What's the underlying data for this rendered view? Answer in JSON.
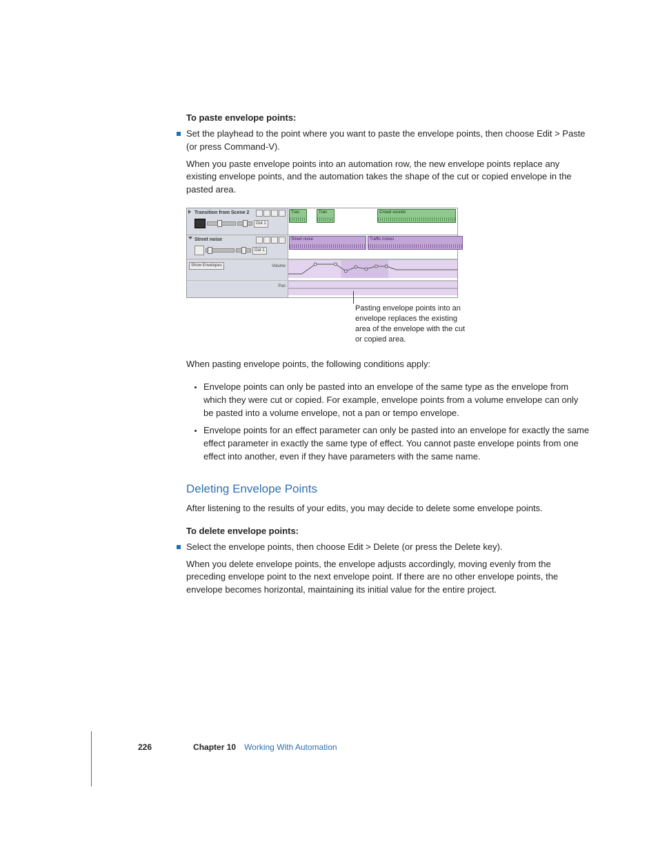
{
  "headings": {
    "paste_title": "To paste envelope points:",
    "delete_title": "To delete envelope points:",
    "section_title": "Deleting Envelope Points"
  },
  "body": {
    "paste_bullet": "Set the playhead to the point where you want to paste the envelope points, then choose Edit > Paste (or press Command-V).",
    "paste_para1": "When you paste envelope points into an automation row, the new envelope points replace any existing envelope points, and the automation takes the shape of the cut or copied envelope in the pasted area.",
    "caption": "Pasting envelope points into an envelope replaces the existing area of the envelope with the cut or copied area.",
    "conditions_intro": "When pasting envelope points, the following conditions apply:",
    "cond1": "Envelope points can only be pasted into an envelope of the same type as the envelope from which they were cut or copied. For example, envelope points from a volume envelope can only be pasted into a volume envelope, not a pan or tempo envelope.",
    "cond2": "Envelope points for an effect parameter can only be pasted into an envelope for exactly the same effect parameter in exactly the same type of effect. You cannot paste envelope points from one effect into another, even if they have parameters with the same name.",
    "delete_intro": "After listening to the results of your edits, you may decide to delete some envelope points.",
    "delete_bullet": "Select the envelope points, then choose Edit > Delete (or press the Delete key).",
    "delete_para": "When you delete envelope points, the envelope adjusts accordingly, moving evenly from the preceding envelope point to the next envelope point. If there are no other envelope points, the envelope becomes horizontal, maintaining its initial value for the entire project."
  },
  "figure": {
    "track1_title": "Transition from Scene 2",
    "track2_title": "Street noise",
    "out_label": "Out 1",
    "show_env": "Show Envelopes",
    "vol_label": "Volume",
    "pan_label": "Pan",
    "clip_tran": "Tran",
    "clip_crowd": "Crowd sounds",
    "clip_street": "Street noise",
    "clip_traffic": "Traffic noises"
  },
  "footer": {
    "page": "226",
    "chapter_label": "Chapter 10",
    "chapter_title": "Working With Automation"
  }
}
